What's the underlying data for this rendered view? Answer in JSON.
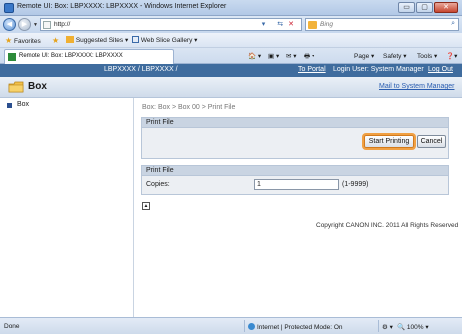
{
  "window": {
    "title": "Remote UI: Box: LBPXXXX: LBPXXXX - Windows Internet Explorer",
    "buttons": {
      "minimize": "▭",
      "maximize": "▢",
      "close": "✕"
    }
  },
  "address": {
    "url": "http://",
    "nav_dropdown": "▼",
    "tool_icons": "▾ ⇆",
    "stop_icon": "✕",
    "search_placeholder": "Bing",
    "search_icon": "⌕"
  },
  "favorites": {
    "favorites_label": "Favorites",
    "suggested_sites": "Suggested Sites ▾",
    "web_slice_gallery": "Web Slice Gallery ▾"
  },
  "tab": {
    "title": "Remote UI: Box: LBPXXXX: LBPXXXX"
  },
  "command_bar": {
    "home": "🏠 ▾",
    "feeds": "▣ ▾",
    "mail": "✉ ▾",
    "print": "🖶 ▾",
    "page": "Page ▾",
    "safety": "Safety ▾",
    "tools": "Tools ▾",
    "help": "❓▾"
  },
  "device_bar": {
    "device": "LBPXXXX / LBPXXXX /",
    "to_portal": "To Portal",
    "login_user": "Login User: System Manager",
    "logout": "Log Out"
  },
  "header": {
    "title": "Box",
    "mail_link": "Mail to System Manager"
  },
  "sidebar": {
    "items": [
      {
        "label": "Box"
      }
    ]
  },
  "breadcrumb": "Box: Box > Box 00 > Print File",
  "print_file_panel": {
    "header": "Print File",
    "start_button": "Start Printing",
    "cancel_button": "Cancel"
  },
  "settings_panel": {
    "header": "Print File",
    "copies_label": "Copies:",
    "copies_value": "1",
    "copies_range": "(1-9999)"
  },
  "footer": {
    "copyright": "Copyright CANON INC. 2011 All Rights Reserved",
    "top_icon": "▲"
  },
  "status": {
    "done": "Done",
    "zone": "Internet | Protected Mode: On",
    "zoom": "100%",
    "zoom_controls": "⚙ ▾"
  },
  "colors": {
    "device_bar": "#3f6c9e",
    "button_focus": "#f0a043",
    "link": "#2a5db0"
  }
}
